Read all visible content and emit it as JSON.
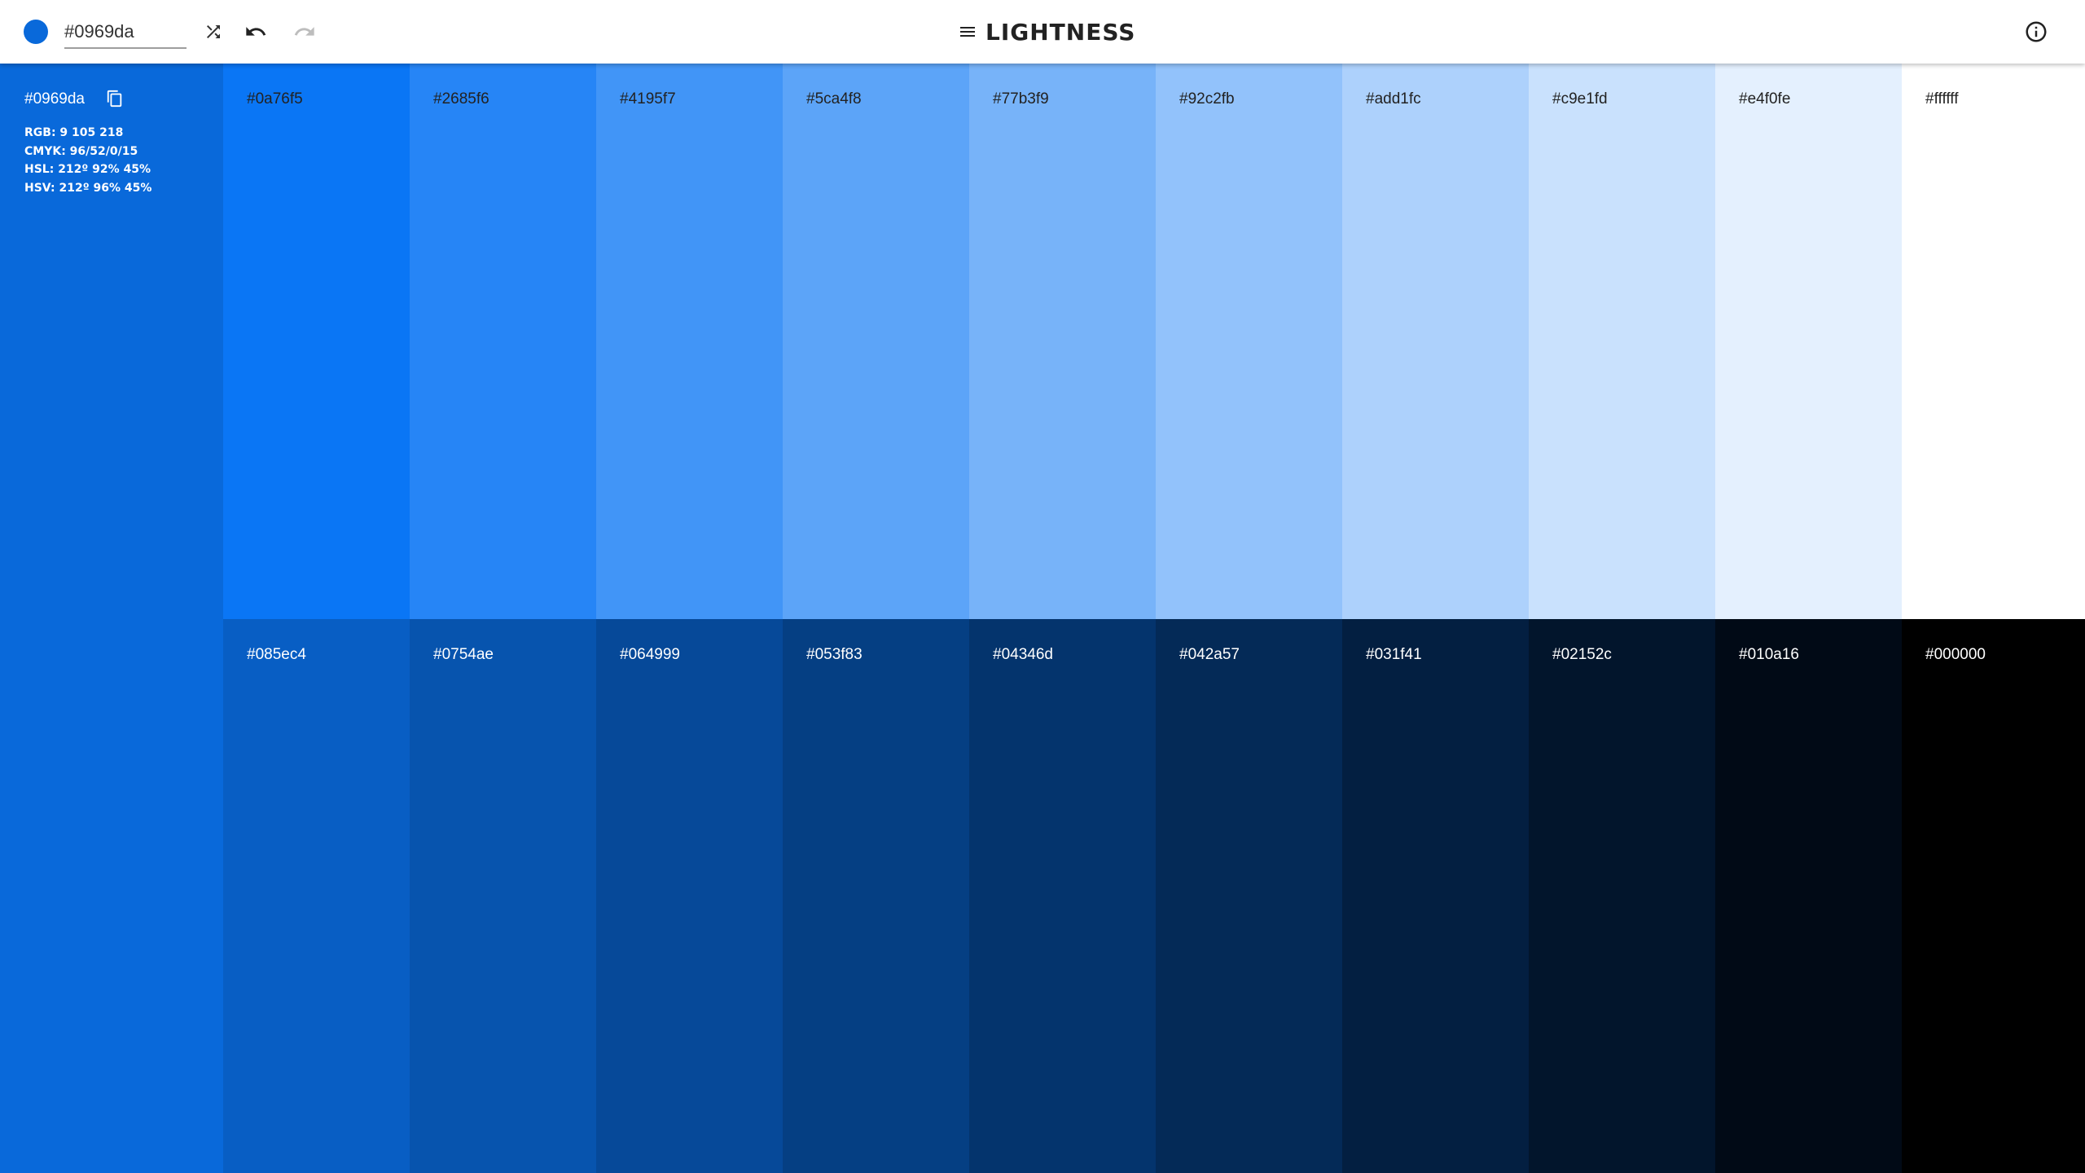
{
  "toolbar": {
    "hex_value": "#0969da",
    "title": "LIGHTNESS",
    "icons": {
      "color_dot": "color-preview-dot",
      "shuffle": "shuffle-icon",
      "undo": "undo-icon",
      "redo": "redo-icon",
      "menu": "menu-icon",
      "info": "info-icon"
    }
  },
  "base_color": {
    "hex": "#0969da",
    "rgb": "RGB: 9 105 218",
    "cmyk": "CMYK: 96/52/0/15",
    "hsl": "HSL: 212º 92% 45%",
    "hsv": "HSV: 212º 96% 45%"
  },
  "lighter": [
    {
      "label": "#0a76f5",
      "color": "#0a76f5",
      "text_color": "#222222"
    },
    {
      "label": "#2685f6",
      "color": "#2685f6",
      "text_color": "#222222"
    },
    {
      "label": "#4195f7",
      "color": "#4195f7",
      "text_color": "#222222"
    },
    {
      "label": "#5ca4f8",
      "color": "#5ca4f8",
      "text_color": "#222222"
    },
    {
      "label": "#77b3f9",
      "color": "#77b3f9",
      "text_color": "#222222"
    },
    {
      "label": "#92c2fb",
      "color": "#92c2fb",
      "text_color": "#222222"
    },
    {
      "label": "#add1fc",
      "color": "#add1fc",
      "text_color": "#222222"
    },
    {
      "label": "#c9e1fd",
      "color": "#c9e1fd",
      "text_color": "#222222"
    },
    {
      "label": "#e4f0fe",
      "color": "#e4f0fe",
      "text_color": "#222222"
    },
    {
      "label": "#ffffff",
      "color": "#ffffff",
      "text_color": "#222222"
    }
  ],
  "darker": [
    {
      "label": "#085ec4",
      "color": "#085ec4",
      "text_color": "#ffffff"
    },
    {
      "label": "#0754ae",
      "color": "#0754ae",
      "text_color": "#ffffff"
    },
    {
      "label": "#064999",
      "color": "#064999",
      "text_color": "#ffffff"
    },
    {
      "label": "#053f83",
      "color": "#053f83",
      "text_color": "#ffffff"
    },
    {
      "label": "#04346d",
      "color": "#04346d",
      "text_color": "#ffffff"
    },
    {
      "label": "#042a57",
      "color": "#042a57",
      "text_color": "#ffffff"
    },
    {
      "label": "#031f41",
      "color": "#031f41",
      "text_color": "#ffffff"
    },
    {
      "label": "#02152c",
      "color": "#02152c",
      "text_color": "#ffffff"
    },
    {
      "label": "#010a16",
      "color": "#010a16",
      "text_color": "#ffffff"
    },
    {
      "label": "#000000",
      "color": "#000000",
      "text_color": "#ffffff"
    }
  ]
}
